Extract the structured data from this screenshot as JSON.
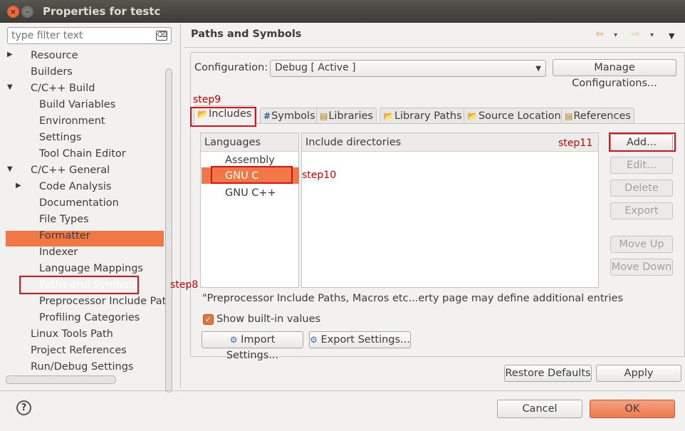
{
  "window": {
    "title": "Properties for testc",
    "close_glyph": "×",
    "min_glyph": "–"
  },
  "filter": {
    "placeholder": "type filter text",
    "clear_glyph": "⌫"
  },
  "tree": {
    "items": [
      {
        "label": "Resource",
        "arrow": "▶"
      },
      {
        "label": "Builders"
      },
      {
        "label": "C/C++ Build",
        "arrow": "▼"
      },
      {
        "label": "Build Variables"
      },
      {
        "label": "Environment"
      },
      {
        "label": "Settings"
      },
      {
        "label": "Tool Chain Editor"
      },
      {
        "label": "C/C++ General",
        "arrow": "▼"
      },
      {
        "label": "Code Analysis",
        "arrow": "▶"
      },
      {
        "label": "Documentation"
      },
      {
        "label": "File Types"
      },
      {
        "label": "Formatter"
      },
      {
        "label": "Indexer"
      },
      {
        "label": "Language Mappings"
      },
      {
        "label": "Paths and Symbols"
      },
      {
        "label": "Preprocessor Include Path"
      },
      {
        "label": "Profiling Categories"
      },
      {
        "label": "Linux Tools Path"
      },
      {
        "label": "Project References"
      },
      {
        "label": "Run/Debug Settings"
      }
    ],
    "selected": "Paths and Symbols"
  },
  "page": {
    "title": "Paths and Symbols",
    "back_icon": "⇦",
    "fwd_icon": "⇨",
    "menu_icon": "▼",
    "dd_icon": "▾"
  },
  "configuration": {
    "label": "Configuration:",
    "value": "Debug  [ Active ]",
    "manage_label": "Manage Configurations..."
  },
  "tabs": [
    {
      "label": "Includes",
      "icon": "📂"
    },
    {
      "label": "Symbols",
      "icon": "#"
    },
    {
      "label": "Libraries",
      "icon": "▤"
    },
    {
      "label": "Library Paths",
      "icon": "📂"
    },
    {
      "label": "Source Location",
      "icon": "📂"
    },
    {
      "label": "References",
      "icon": "▤"
    }
  ],
  "languages": {
    "header": "Languages",
    "items": [
      "Assembly",
      "GNU C",
      "GNU C++"
    ],
    "selected": "GNU C"
  },
  "includes": {
    "header": "Include directories"
  },
  "side_buttons": {
    "add": "Add...",
    "edit": "Edit...",
    "delete": "Delete",
    "export": "Export",
    "move_up": "Move Up",
    "move_down": "Move Down"
  },
  "note": "\"Preprocessor Include Paths, Macros etc...erty page may define additional entries",
  "show_builtin": {
    "label": "Show built-in values",
    "checked": true,
    "glyph": "✓"
  },
  "import_settings": {
    "label": "Import Settings...",
    "icon": "⚙"
  },
  "export_settings": {
    "label": "Export Settings...",
    "icon": "⚙"
  },
  "restore_defaults": "Restore Defaults",
  "apply": "Apply",
  "cancel": "Cancel",
  "ok": "OK",
  "help_glyph": "?",
  "annotations": {
    "step8": "step8",
    "step9": "step9",
    "step10": "step10",
    "step11": "step11"
  },
  "colors": {
    "accent": "#f07746",
    "annotation": "#e0101a"
  }
}
